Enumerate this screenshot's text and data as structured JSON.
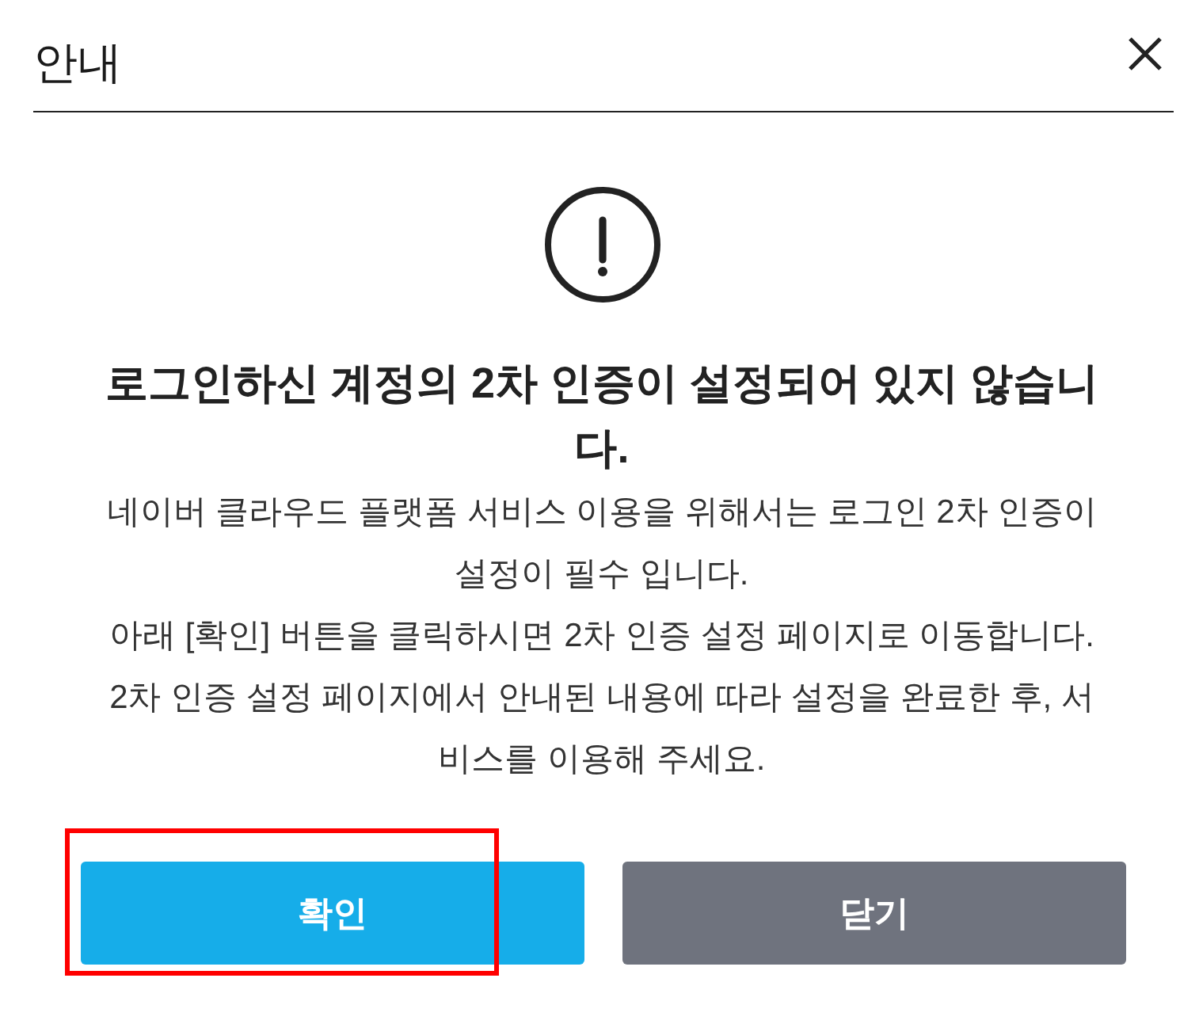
{
  "dialog": {
    "title": "안내"
  },
  "message": {
    "heading": "로그인하신 계정의 2차 인증이 설정되어 있지 않습니다.",
    "paragraphs": [
      "네이버 클라우드 플랫폼 서비스 이용을 위해서는 로그인 2차 인증이 설정이 필수 입니다.",
      "아래 [확인] 버튼을 클릭하시면 2차 인증 설정 페이지로 이동합니다.",
      "2차 인증 설정 페이지에서 안내된 내용에 따라 설정을 완료한 후, 서비스를 이용해 주세요."
    ]
  },
  "buttons": [
    {
      "label": "확인",
      "kind": "primary",
      "highlighted": true
    },
    {
      "label": "닫기",
      "kind": "secondary",
      "highlighted": false
    }
  ]
}
